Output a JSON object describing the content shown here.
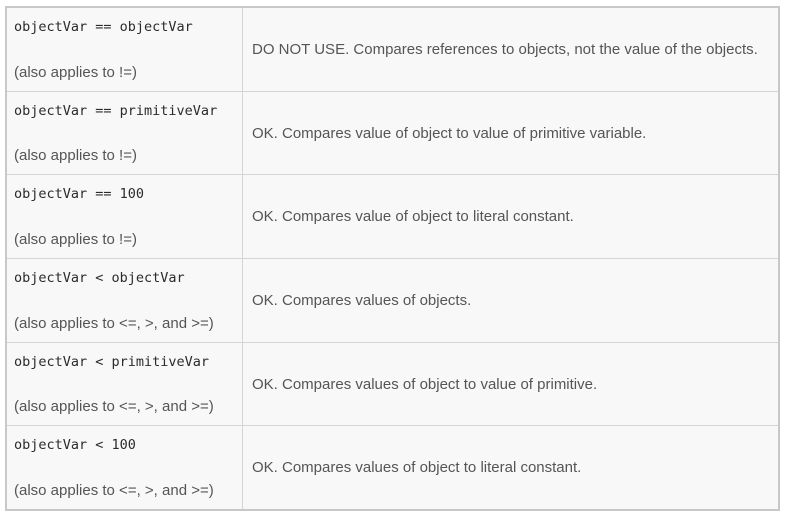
{
  "table": {
    "rows": [
      {
        "code": "objectVar == objectVar",
        "note": "(also applies to !=)",
        "description": "DO NOT USE. Compares references to objects, not the value of the objects."
      },
      {
        "code": "objectVar == primitiveVar",
        "note": "(also applies to !=)",
        "description": "OK. Compares value of object to value of primitive variable."
      },
      {
        "code": "objectVar == 100",
        "note": "(also applies to !=)",
        "description": "OK. Compares value of object to literal constant."
      },
      {
        "code": "objectVar < objectVar",
        "note": "(also applies to <=, >, and >=)",
        "description": "OK. Compares values of objects."
      },
      {
        "code": "objectVar < primitiveVar",
        "note": "(also applies to <=, >, and >=)",
        "description": "OK. Compares values of object to value of primitive."
      },
      {
        "code": "objectVar < 100",
        "note": "(also applies to <=, >, and >=)",
        "description": "OK. Compares values of object to literal constant."
      }
    ]
  }
}
